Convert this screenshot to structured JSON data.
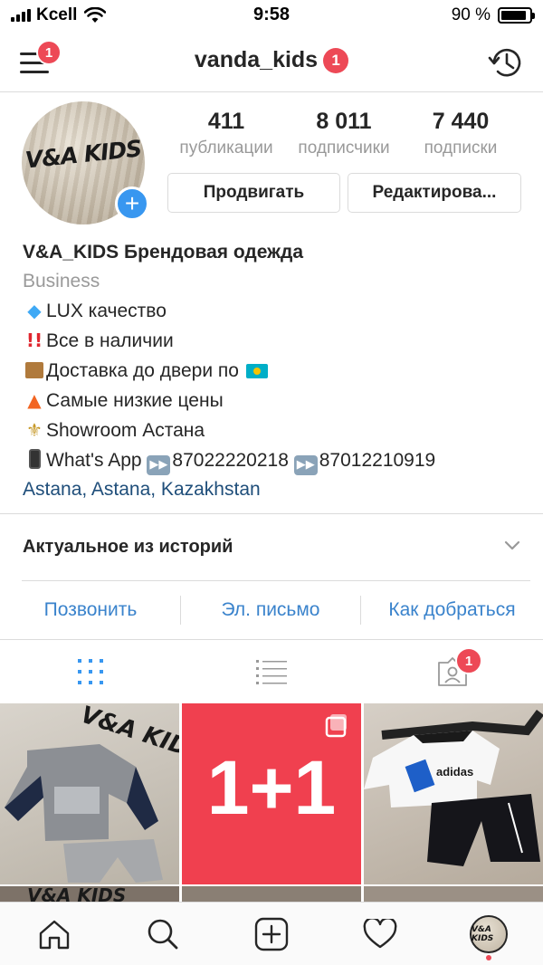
{
  "status_bar": {
    "carrier": "Kcell",
    "time": "9:58",
    "battery": "90 %",
    "battery_level": 0.9
  },
  "nav": {
    "username": "vanda_kids",
    "menu_badge": "1",
    "title_badge": "1"
  },
  "profile": {
    "avatar_text": "V&A KIDS",
    "stats": [
      {
        "value": "411",
        "label": "публикации"
      },
      {
        "value": "8 011",
        "label": "подписчики"
      },
      {
        "value": "7 440",
        "label": "подписки"
      }
    ],
    "promote_label": "Продвигать",
    "edit_label": "Редактирова..."
  },
  "bio": {
    "title": "V&A_KIDS  Брендовая одежда",
    "category": "Business",
    "lines": [
      {
        "icon": "gem-icon",
        "text": "LUX качество"
      },
      {
        "icon": "double-exclamation-icon",
        "text": "Все в наличии"
      },
      {
        "icon": "package-icon",
        "text": "Доставка до двери по"
      },
      {
        "icon": "fire-icon",
        "text": "Самые низкие цены"
      },
      {
        "icon": "fleur-de-lis-icon",
        "text": "Showroom Астана"
      }
    ],
    "whatsapp_label": "What's App",
    "phone_1": "87022220218",
    "phone_2": "87012210919",
    "location": "Astana, Astana, Kazakhstan"
  },
  "highlights": {
    "label": "Актуальное из историй"
  },
  "contacts": {
    "call": "Позвонить",
    "email": "Эл. письмо",
    "directions": "Как добраться"
  },
  "tabs": {
    "tagged_badge": "1",
    "active": "grid"
  },
  "grid": {
    "tile_1_caption": "V&A KIDS",
    "tile_2_text": "1+1",
    "tile_3_caption": "adidas",
    "row2_caption": "V&A KIDS"
  },
  "colors": {
    "accent_blue": "#3897f0",
    "badge_red": "#ed4956",
    "link_blue": "#3a83cc",
    "promo_red": "#f0404f"
  }
}
